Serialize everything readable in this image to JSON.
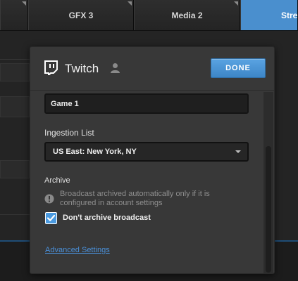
{
  "tabs": [
    {
      "label": ""
    },
    {
      "label": "GFX 3"
    },
    {
      "label": "Media 2"
    },
    {
      "label": "Strea"
    }
  ],
  "dialog": {
    "service_icon": "twitch-logo-icon",
    "title": "Twitch",
    "account_icon": "user-icon",
    "done_label": "DONE",
    "stream_title_value": "Game 1",
    "ingestion_label": "Ingestion List",
    "ingestion_selected": "US East: New York, NY",
    "archive_label": "Archive",
    "archive_info_icon": "info-icon",
    "archive_info_text": "Broadcast archived automatically only if it is configured in account settings",
    "archive_checkbox_label": "Don't archive broadcast",
    "archive_checkbox_checked": true,
    "advanced_settings_label": "Advanced Settings"
  },
  "colors": {
    "accent": "#4a8fce",
    "link": "#4a90d9",
    "dialog_bg": "#383838"
  }
}
